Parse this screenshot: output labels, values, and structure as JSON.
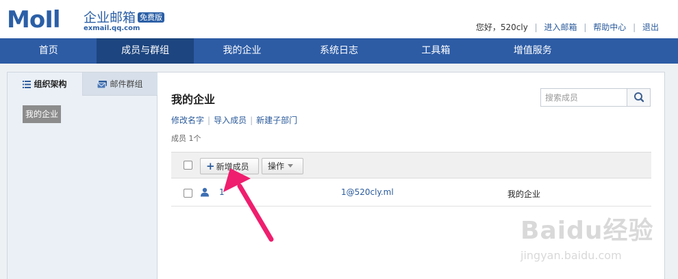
{
  "brand": {
    "logo_text": "MoIl",
    "name_cn": "企业邮箱",
    "badge": "免费版",
    "domain": "exmail.qq.com"
  },
  "user_bar": {
    "greeting": "您好，520cly",
    "links": [
      "进入邮箱",
      "帮助中心",
      "退出"
    ]
  },
  "nav": {
    "items": [
      "首页",
      "成员与群组",
      "我的企业",
      "系统日志",
      "工具箱",
      "增值服务"
    ],
    "active_index": 1
  },
  "sidebar": {
    "tabs": [
      "组织架构",
      "邮件群组"
    ],
    "tree_root": "我的企业"
  },
  "content": {
    "title": "我的企业",
    "search_placeholder": "搜索成员",
    "actions": [
      "修改名字",
      "导入成员",
      "新建子部门"
    ],
    "count_text": "成员 1个",
    "toolbar": {
      "add_label": "新增成员",
      "operate_label": "操作"
    },
    "members": [
      {
        "name": "1",
        "email": "1@520cly.ml",
        "dept": "我的企业"
      }
    ]
  },
  "watermark": {
    "main": "Baidu经验",
    "sub": "jingyan.baidu.com"
  },
  "colors": {
    "nav_bg": "#2d5ca5",
    "nav_active": "#1d457f",
    "link": "#2a5a9b",
    "arrow": "#ef1e6e"
  }
}
